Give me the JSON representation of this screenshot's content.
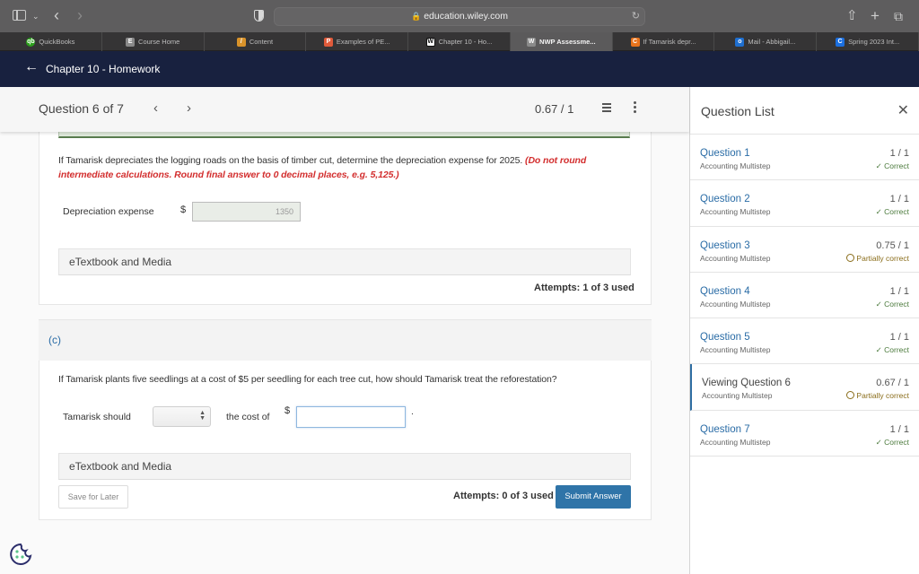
{
  "browser": {
    "url": "education.wiley.com",
    "tabs": [
      {
        "label": "QuickBooks",
        "icon": "quickbooks-icon",
        "color": "#2ca01c",
        "glyph": "qb"
      },
      {
        "label": "Course Home",
        "icon": "course-home-icon",
        "color": "#8a8a8a",
        "glyph": "E"
      },
      {
        "label": "Content",
        "icon": "content-icon",
        "color": "#d9932a",
        "glyph": "/"
      },
      {
        "label": "Examples of PE...",
        "icon": "examples-icon",
        "color": "#e05a3a",
        "glyph": "P"
      },
      {
        "label": "Chapter 10 - Ho...",
        "icon": "wiley-icon",
        "color": "#111111",
        "glyph": "W"
      },
      {
        "label": "NWP Assessme...",
        "icon": "wiley-icon",
        "color": "#8a8a8a",
        "glyph": "W",
        "active": true
      },
      {
        "label": "If Tamarisk depr...",
        "icon": "chegg-icon",
        "color": "#e8731c",
        "glyph": "C"
      },
      {
        "label": "Mail - Abbigail...",
        "icon": "outlook-icon",
        "color": "#1f6fd0",
        "glyph": "o"
      },
      {
        "label": "Spring 2023 Int...",
        "icon": "c-icon",
        "color": "#1b6fe0",
        "glyph": "C"
      }
    ]
  },
  "header": {
    "course_title": "Chapter 10 - Homework"
  },
  "question_bar": {
    "position": "Question 6 of 7",
    "score": "0.67 / 1"
  },
  "part_b": {
    "prompt": "If Tamarisk depreciates the logging roads on the basis of timber cut, determine the depreciation expense for 2025.",
    "instruction": "(Do not round intermediate calculations. Round final answer to 0 decimal places, e.g. 5,125.)",
    "field_label": "Depreciation expense",
    "currency": "$",
    "field_value": "1350",
    "etextbook": "eTextbook and Media",
    "attempts": "Attempts: 1 of 3 used"
  },
  "part_c": {
    "letter": "(c)",
    "prompt": "If Tamarisk plants five seedlings at a cost of $5 per seedling for each tree cut, how should Tamarisk treat the reforestation?",
    "label_before": "Tamarisk should",
    "select_value": "",
    "label_middle": "the cost of",
    "currency": "$",
    "input_value": "",
    "trailing": ".",
    "etextbook": "eTextbook and Media",
    "save_label": "Save for Later",
    "attempts": "Attempts: 0 of 3 used",
    "submit_label": "Submit Answer"
  },
  "question_list": {
    "title": "Question List",
    "items": [
      {
        "name": "Question 1",
        "type": "Accounting Multistep",
        "score": "1 / 1",
        "status": "Correct",
        "state": "correct"
      },
      {
        "name": "Question 2",
        "type": "Accounting Multistep",
        "score": "1 / 1",
        "status": "Correct",
        "state": "correct"
      },
      {
        "name": "Question 3",
        "type": "Accounting Multistep",
        "score": "0.75 / 1",
        "status": "Partially correct",
        "state": "partial"
      },
      {
        "name": "Question 4",
        "type": "Accounting Multistep",
        "score": "1 / 1",
        "status": "Correct",
        "state": "correct"
      },
      {
        "name": "Question 5",
        "type": "Accounting Multistep",
        "score": "1 / 1",
        "status": "Correct",
        "state": "correct"
      },
      {
        "name": "Viewing Question 6",
        "type": "Accounting Multistep",
        "score": "0.67 / 1",
        "status": "Partially correct",
        "state": "partial",
        "current": true
      },
      {
        "name": "Question 7",
        "type": "Accounting Multistep",
        "score": "1 / 1",
        "status": "Correct",
        "state": "correct"
      }
    ]
  }
}
